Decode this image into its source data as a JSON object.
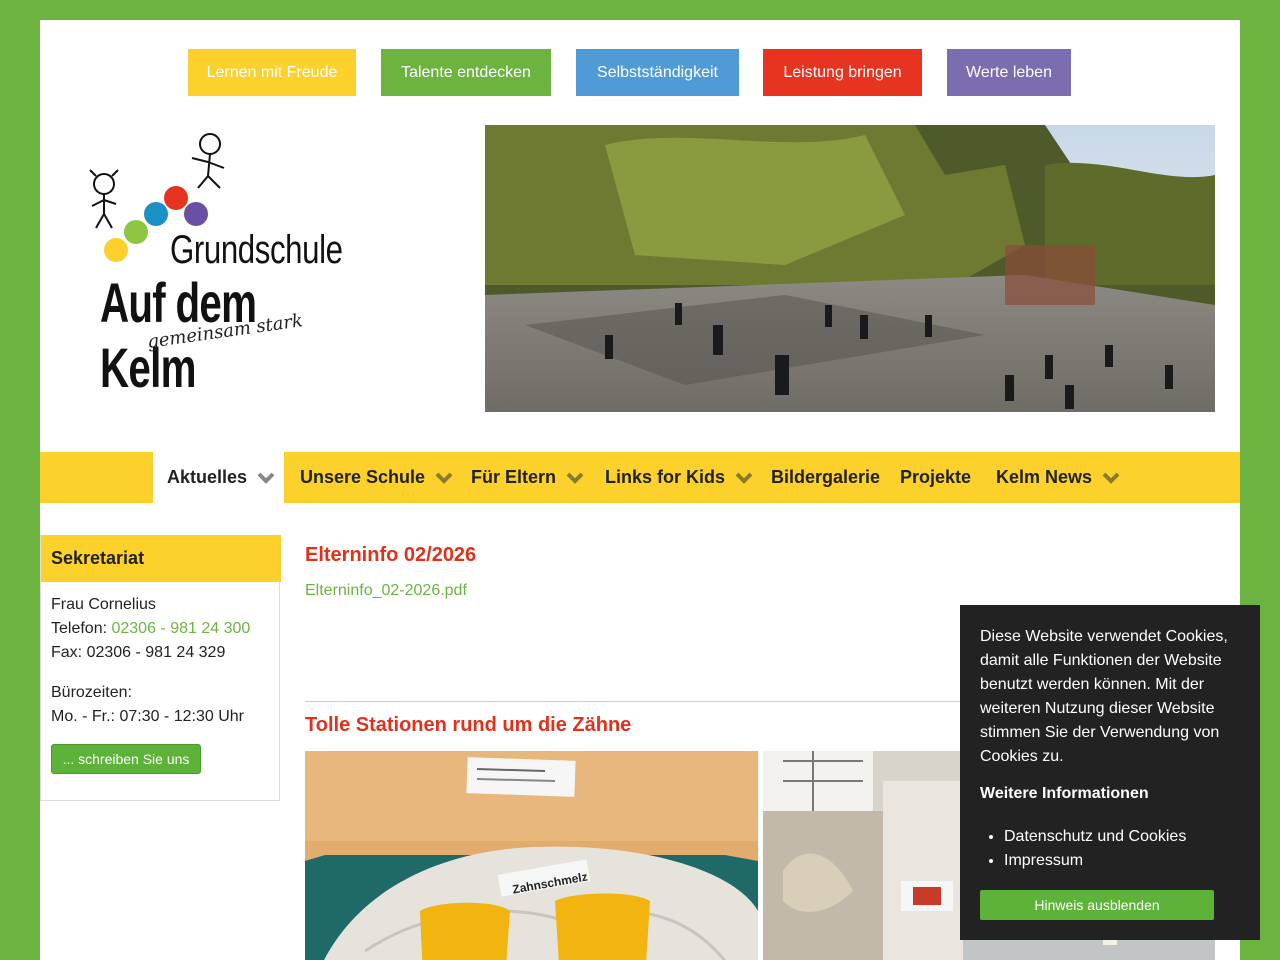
{
  "pills": [
    {
      "label": "Lernen mit Freude",
      "color": "#fdd12b"
    },
    {
      "label": "Talente entdecken",
      "color": "#6db33f"
    },
    {
      "label": "Selbstständigkeit",
      "color": "#4f9bd6"
    },
    {
      "label": "Leistung bringen",
      "color": "#e63421"
    },
    {
      "label": "Werte leben",
      "color": "#7b6db0"
    }
  ],
  "logo": {
    "line1": "Grundschule",
    "line2": "Auf dem Kelm",
    "slogan": "gemeinsam stark"
  },
  "nav": {
    "items": [
      {
        "label": "Aktuelles",
        "has_dropdown": true,
        "active": true
      },
      {
        "label": "Unsere Schule",
        "has_dropdown": true
      },
      {
        "label": "Für Eltern",
        "has_dropdown": true
      },
      {
        "label": "Links for Kids",
        "has_dropdown": true
      },
      {
        "label": "Bildergalerie",
        "has_dropdown": false
      },
      {
        "label": "Projekte",
        "has_dropdown": false
      },
      {
        "label": "Kelm News",
        "has_dropdown": true
      }
    ]
  },
  "sidebar": {
    "title": "Sekretariat",
    "name": "Frau Cornelius",
    "phone_label": "Telefon: ",
    "phone": "02306 - 981 24 300",
    "fax": "Fax: 02306 - 981 24 329",
    "hours_label": "Bürozeiten:",
    "hours": "Mo. - Fr.: 07:30 - 12:30 Uhr",
    "button": "... schreiben Sie uns"
  },
  "posts": [
    {
      "title": "Elterninfo 02/2026",
      "link": "Elterninfo_02-2026.pdf"
    },
    {
      "title": "Tolle Stationen rund um die Zähne",
      "photo_label": "Zahnschmelz"
    }
  ],
  "cookie": {
    "text": "Diese Website verwendet Cookies, damit alle Funktionen der Website benutzt werden können. Mit der weiteren Nutzung dieser Website stimmen Sie der Verwendung von Cookies zu.",
    "more": "Weitere Informationen",
    "links": [
      "Datenschutz und Cookies",
      "Impressum"
    ],
    "button": "Hinweis ausblenden"
  }
}
